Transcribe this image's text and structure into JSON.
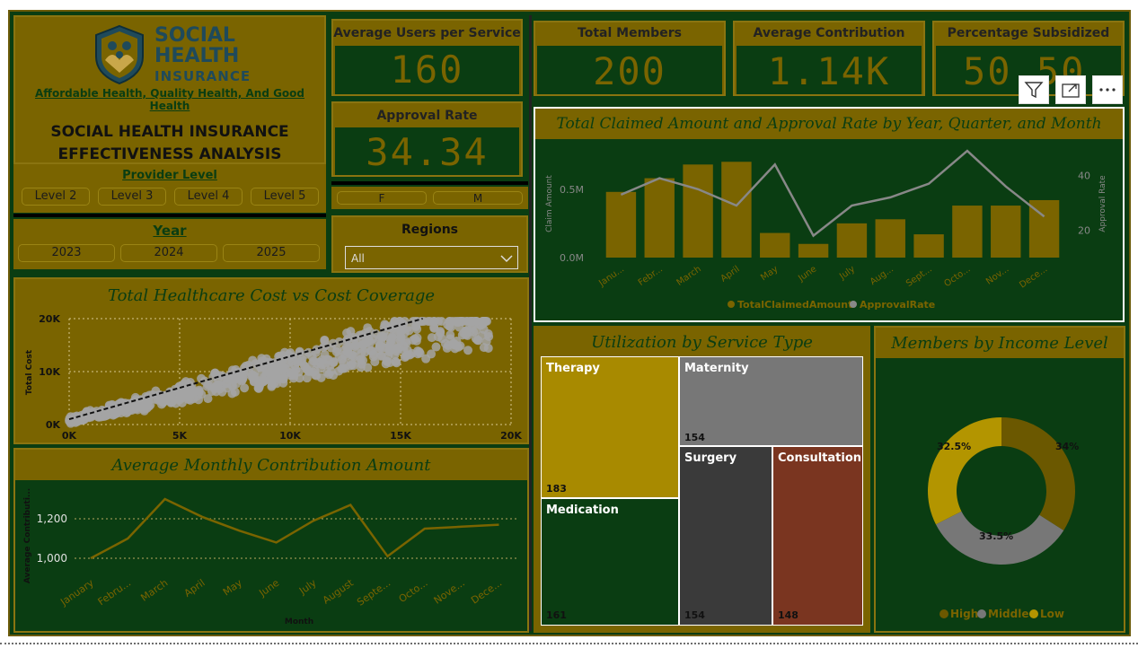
{
  "logo": {
    "line1": "SOCIAL",
    "line2": "HEALTH",
    "line3": "INSURANCE"
  },
  "tagline": "Affordable Health, Quality Health, And Good Health",
  "report_title_1": "SOCIAL HEALTH INSURANCE",
  "report_title_2": "EFFECTIVENESS ANALYSIS",
  "provider_level": {
    "label": "Provider Level",
    "options": [
      "Level 2",
      "Level 3",
      "Level 4",
      "Level 5"
    ]
  },
  "year": {
    "label": "Year",
    "options": [
      "2023",
      "2024",
      "2025"
    ]
  },
  "gender": {
    "options": [
      "F",
      "M"
    ]
  },
  "regions": {
    "label": "Regions",
    "selected": "All"
  },
  "kpis": {
    "avg_users": {
      "label": "Average Users per Service",
      "value": "160"
    },
    "approval_rate": {
      "label": "Approval Rate",
      "value": "34.34"
    },
    "total_members": {
      "label": "Total Members",
      "value": "200"
    },
    "avg_contribution": {
      "label": "Average Contribution",
      "value": "1.14K"
    },
    "pct_subsidized": {
      "label": "Percentage Subsidized",
      "value": "50.50"
    }
  },
  "colors": {
    "dark_green": "#0a3d12",
    "olive": "#7a6400",
    "gray": "#777777",
    "gold": "#a88a00",
    "rust": "#7a3520"
  },
  "claimed_chart": {
    "title": "Total Claimed Amount and Approval Rate by Year, Quarter, and Month",
    "ylabel_left": "Claim Amount",
    "ylabel_right": "Approval Rate",
    "left_ticks": [
      "0.0M",
      "0.5M"
    ],
    "right_ticks": [
      "20",
      "40"
    ],
    "legend": [
      "TotalClaimedAmount",
      "ApprovalRate"
    ]
  },
  "scatter_chart": {
    "title": "Total Healthcare Cost vs Cost Coverage",
    "ylabel": "Total Cost",
    "y_ticks": [
      "0K",
      "10K",
      "20K"
    ],
    "x_ticks": [
      "0K",
      "5K",
      "10K",
      "15K",
      "20K"
    ]
  },
  "contribution_chart": {
    "title": "Average Monthly Contribution Amount",
    "ylabel": "Average Contributi...",
    "xlabel": "Month",
    "y_ticks": [
      "1,000",
      "1,200"
    ]
  },
  "utilization": {
    "title": "Utilization by Service Type",
    "items": [
      {
        "name": "Therapy",
        "value": "183"
      },
      {
        "name": "Maternity",
        "value": "154"
      },
      {
        "name": "Medication",
        "value": "161"
      },
      {
        "name": "Surgery",
        "value": "154"
      },
      {
        "name": "Consultation",
        "value": "148"
      }
    ]
  },
  "income": {
    "title": "Members by Income Level",
    "slices": [
      {
        "name": "High",
        "label": "34%",
        "value": 34,
        "color": "#6b5800"
      },
      {
        "name": "Middle",
        "label": "33.5%",
        "value": 33.5,
        "color": "#777777"
      },
      {
        "name": "Low",
        "label": "32.5%",
        "value": 32.5,
        "color": "#b39500"
      }
    ]
  },
  "chart_data": [
    {
      "type": "bar",
      "title": "Total Claimed Amount and Approval Rate by Year, Quarter, and Month",
      "categories": [
        "Janu...",
        "Febr...",
        "March",
        "April",
        "May",
        "June",
        "July",
        "Aug...",
        "Sept...",
        "Octo...",
        "Nov...",
        "Dece..."
      ],
      "series": [
        {
          "name": "TotalClaimedAmount",
          "values": [
            0.48,
            0.58,
            0.68,
            0.7,
            0.18,
            0.1,
            0.25,
            0.28,
            0.17,
            0.38,
            0.38,
            0.42
          ]
        },
        {
          "name": "ApprovalRate",
          "values": [
            33,
            39,
            35,
            29,
            44,
            18,
            29,
            32,
            37,
            49,
            36,
            25
          ]
        }
      ],
      "ylim": [
        0,
        0.8
      ],
      "y2lim": [
        10,
        50
      ]
    },
    {
      "type": "scatter",
      "title": "Total Healthcare Cost vs Cost Coverage",
      "ylabel": "Total Cost",
      "xlim": [
        0,
        20000
      ],
      "ylim": [
        0,
        20000
      ],
      "trend": [
        [
          0,
          1000
        ],
        [
          16000,
          20000
        ]
      ]
    },
    {
      "type": "line",
      "title": "Average Monthly Contribution Amount",
      "categories": [
        "January",
        "Febru...",
        "March",
        "April",
        "May",
        "June",
        "July",
        "August",
        "Septe...",
        "Octo...",
        "Nove...",
        "Dece..."
      ],
      "values": [
        1000,
        1100,
        1300,
        1210,
        1140,
        1080,
        1190,
        1270,
        1010,
        1150,
        1160,
        1170
      ],
      "xlabel": "Month",
      "ylabel": "Average Contributi...",
      "ylim": [
        950,
        1350
      ]
    },
    {
      "type": "pie",
      "title": "Members by Income Level",
      "categories": [
        "High",
        "Middle",
        "Low"
      ],
      "values": [
        34,
        33.5,
        32.5
      ]
    }
  ]
}
